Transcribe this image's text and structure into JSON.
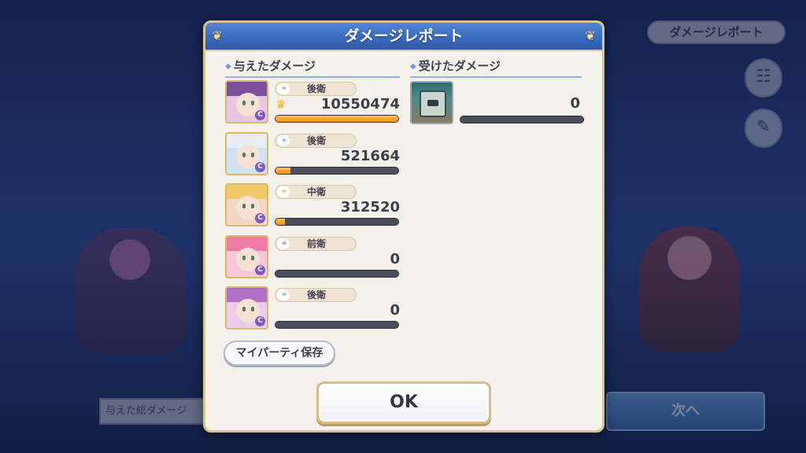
{
  "background": {
    "damage_report_button": "ダメージレポート",
    "bottom_left_label": "与えた総ダメージ",
    "next_button": "次へ",
    "side_icons": [
      "party-icon",
      "report-icon"
    ]
  },
  "dialog": {
    "title": "ダメージレポート",
    "dealt_section_title": "与えたダメージ",
    "taken_section_title": "受けたダメージ",
    "dealt": [
      {
        "role": "後衛",
        "role_type": "back",
        "damage": "10550474",
        "bar_fraction": 1.0,
        "crown": true,
        "portrait_bg": "#e7c7e3",
        "hair": "#7c4f9a"
      },
      {
        "role": "後衛",
        "role_type": "back",
        "damage": "521664",
        "bar_fraction": 0.12,
        "crown": false,
        "portrait_bg": "#cfe1f2",
        "hair": "#e6edf5"
      },
      {
        "role": "中衛",
        "role_type": "mid",
        "damage": "312520",
        "bar_fraction": 0.08,
        "crown": false,
        "portrait_bg": "#f3d7c3",
        "hair": "#f2c96a"
      },
      {
        "role": "前衛",
        "role_type": "front",
        "damage": "0",
        "bar_fraction": 0.0,
        "crown": false,
        "portrait_bg": "#f6c6d9",
        "hair": "#f07aa6"
      },
      {
        "role": "後衛",
        "role_type": "back",
        "damage": "0",
        "bar_fraction": 0.0,
        "crown": false,
        "portrait_bg": "#e8cdea",
        "hair": "#b070c4"
      }
    ],
    "taken": [
      {
        "damage": "0",
        "bar_fraction": 0.0
      }
    ],
    "party_save_button": "マイパーティ保存",
    "ok_button": "OK"
  },
  "colors": {
    "header_blue": "#3a6cbf",
    "bar_orange": "#f0901f",
    "gold_border": "#d8c48f"
  }
}
